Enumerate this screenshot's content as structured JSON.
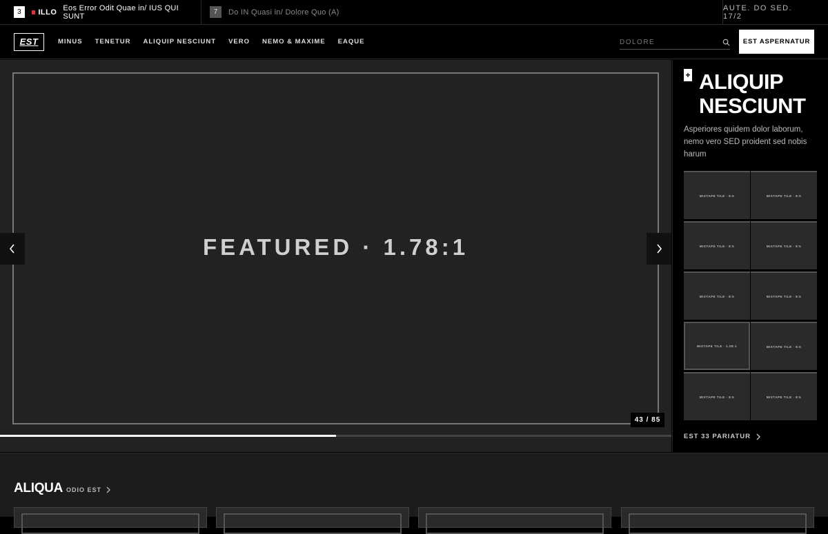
{
  "ticker": {
    "item1": {
      "number": "3",
      "category": "ILLO",
      "text": "Eos Error Odit Quae in/ IUS QUI SUNT"
    },
    "item2": {
      "number": "7",
      "text": "Do IN Quasi in/ Dolore Quo (A)"
    },
    "right_text": "AUTE. DO SED. 17/2"
  },
  "nav": {
    "logo": "EST",
    "links": [
      "MINUS",
      "TENETUR",
      "ALIQUIP NESCIUNT",
      "VERO",
      "NEMO & MAXIME",
      "EAQUE"
    ],
    "search_placeholder": "DOLORE",
    "cta_label": "EST ASPERNATUR"
  },
  "hero": {
    "title": "FEATURED · 1.78:1",
    "counter": "43 / 85",
    "progress_fraction": 0.5
  },
  "side": {
    "plus": "+",
    "title": "ALIQUIP NESCIUNT",
    "description": "Asperiores quidem dolor laborum, nemo vero SED proident sed nobis harum",
    "tiles": [
      "MIXTAPE TILE · 8:5",
      "MIXTAPE TILE · 8:5",
      "MIXTAPE TILE · 8:5",
      "MIXTAPE TILE · 8:5",
      "MIXTAPE TILE · 8:5",
      "MIXTAPE TILE · 8:5",
      "MIXTAPE TILE · 1.08:1",
      "MIXTAPE TILE · 8:5",
      "MIXTAPE TILE · 8:5",
      "MIXTAPE TILE · 8:5"
    ],
    "link_label": "EST 33 PARIATUR"
  },
  "section": {
    "title": "ALIQUA",
    "link_label": "ODIO EST"
  },
  "colors": {
    "accent_red": "#e53030",
    "background": "#000000",
    "panel": "#222222"
  }
}
